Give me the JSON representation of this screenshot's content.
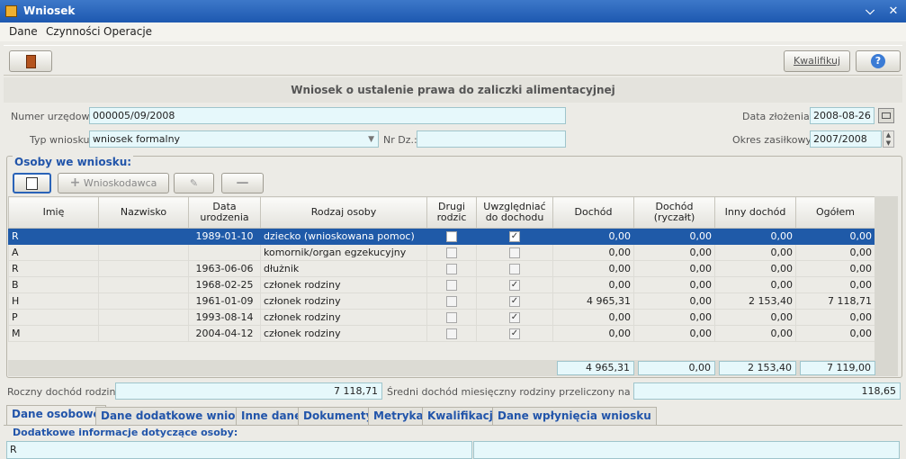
{
  "window": {
    "title": "Wniosek",
    "minimize_icon": "chevron-down",
    "close_icon": "x"
  },
  "menu": [
    "Dane",
    "Czynności",
    "Operacje"
  ],
  "toolbar": {
    "qualify_label": "Kwalifikuj"
  },
  "heading": "Wniosek o ustalenie prawa do zaliczki alimentacyjnej",
  "form": {
    "official_number_label": "Numer urzędowy:",
    "official_number": "000005/09/2008",
    "type_label": "Typ wniosku:",
    "type_value": "wniosek formalny",
    "nr_dz_label": "Nr Dz.:",
    "nr_dz_value": "",
    "date_label": "Data złożenia:",
    "date_value": "2008-08-26",
    "period_label": "Okres zasiłkowy:",
    "period_value": "2007/2008"
  },
  "persons": {
    "group_title": "Osoby we wniosku:",
    "applicant_button": "Wnioskodawca",
    "columns": [
      "Imię",
      "Nazwisko",
      "Data urodzenia",
      "Rodzaj osoby",
      "Drugi rodzic",
      "Uwzględniać do dochodu",
      "Dochód",
      "Dochód (ryczałt)",
      "Inny dochód",
      "Ogółem"
    ],
    "rows": [
      {
        "first": "R",
        "last": "",
        "birth": "1989-01-10",
        "kind": "dziecko (wnioskowana pomoc)",
        "second": false,
        "include": true,
        "income": "0,00",
        "flat": "0,00",
        "other": "0,00",
        "total": "0,00"
      },
      {
        "first": "A",
        "last": "",
        "birth": "",
        "kind": "komornik/organ egzekucyjny",
        "second": false,
        "include": false,
        "income": "0,00",
        "flat": "0,00",
        "other": "0,00",
        "total": "0,00"
      },
      {
        "first": "R",
        "last": "",
        "birth": "1963-06-06",
        "kind": "dłużnik",
        "second": false,
        "include": false,
        "income": "0,00",
        "flat": "0,00",
        "other": "0,00",
        "total": "0,00"
      },
      {
        "first": "B",
        "last": "",
        "birth": "1968-02-25",
        "kind": "członek rodziny",
        "second": false,
        "include": true,
        "income": "0,00",
        "flat": "0,00",
        "other": "0,00",
        "total": "0,00"
      },
      {
        "first": "H",
        "last": "",
        "birth": "1961-01-09",
        "kind": "członek rodziny",
        "second": false,
        "include": true,
        "income": "4 965,31",
        "flat": "0,00",
        "other": "2 153,40",
        "total": "7 118,71"
      },
      {
        "first": "P",
        "last": "",
        "birth": "1993-08-14",
        "kind": "członek rodziny",
        "second": false,
        "include": true,
        "income": "0,00",
        "flat": "0,00",
        "other": "0,00",
        "total": "0,00"
      },
      {
        "first": "M",
        "last": "",
        "birth": "2004-04-12",
        "kind": "członek rodziny",
        "second": false,
        "include": true,
        "income": "0,00",
        "flat": "0,00",
        "other": "0,00",
        "total": "0,00"
      }
    ],
    "totals": {
      "income": "4 965,31",
      "flat": "0,00",
      "other": "2 153,40",
      "total": "7 119,00"
    }
  },
  "summary": {
    "annual_label": "Roczny dochód rodziny:",
    "annual_value": "7 118,71",
    "monthly_label": "Średni dochód miesięczny rodziny przeliczony na osobę:",
    "monthly_value": "118,65"
  },
  "tabs": [
    "Dane osobowe",
    "Dane dodatkowe wniosku",
    "Inne dane",
    "Dokumenty",
    "Metryka",
    "Kwalifikacja",
    "Dane wpłynięcia wniosku"
  ],
  "details": {
    "title": "Dodatkowe informacje dotyczące osoby:",
    "value": "R"
  }
}
